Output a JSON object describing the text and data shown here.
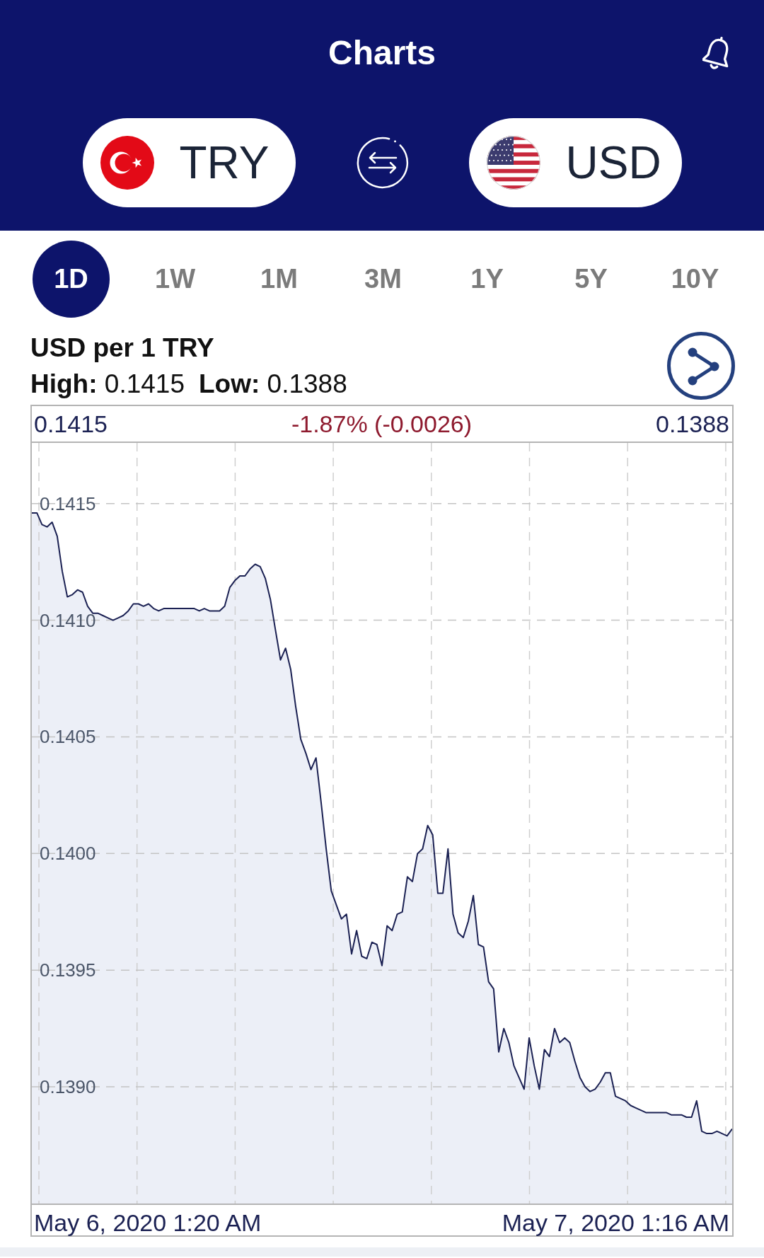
{
  "header": {
    "title": "Charts"
  },
  "currency_pair": {
    "from": {
      "code": "TRY"
    },
    "to": {
      "code": "USD"
    }
  },
  "ranges": [
    {
      "label": "1D",
      "selected": true
    },
    {
      "label": "1W",
      "selected": false
    },
    {
      "label": "1M",
      "selected": false
    },
    {
      "label": "3M",
      "selected": false
    },
    {
      "label": "1Y",
      "selected": false
    },
    {
      "label": "5Y",
      "selected": false
    },
    {
      "label": "10Y",
      "selected": false
    }
  ],
  "summary": {
    "title": "USD per 1 TRY",
    "stats": [
      "**High:** 0.1415",
      "**Low:** 0.1388"
    ]
  },
  "chart": {
    "start_value": "0.1415",
    "change": "-1.87% (-0.0026)",
    "end_value": "0.1388",
    "start_time": "May 6, 2020 1:20 AM",
    "end_time": "May 7, 2020 1:16 AM",
    "chart_data": {
      "type": "area",
      "grid": true,
      "ylim": [
        0.1385,
        0.14176
      ],
      "yticks": [
        {
          "value": 0.139,
          "label": "0.1390"
        },
        {
          "value": 0.1395,
          "label": "0.1395"
        },
        {
          "value": 0.14,
          "label": "0.1400"
        },
        {
          "value": 0.1405,
          "label": "0.1405"
        },
        {
          "value": 0.141,
          "label": "0.1410"
        },
        {
          "value": 0.1415,
          "label": "0.1415"
        }
      ],
      "series": [
        {
          "color": "#1b2153",
          "values": [
            0.14146,
            0.14146,
            0.14141,
            0.1414,
            0.14142,
            0.14136,
            0.14121,
            0.1411,
            0.14111,
            0.14113,
            0.14112,
            0.14106,
            0.14103,
            0.14103,
            0.14102,
            0.14101,
            0.141,
            0.14101,
            0.14102,
            0.14104,
            0.14107,
            0.14107,
            0.14106,
            0.14107,
            0.14105,
            0.14104,
            0.14105,
            0.14105,
            0.14105,
            0.14105,
            0.14105,
            0.14105,
            0.14105,
            0.14104,
            0.14105,
            0.14104,
            0.14104,
            0.14104,
            0.14106,
            0.14114,
            0.14117,
            0.14119,
            0.14119,
            0.14122,
            0.14124,
            0.14123,
            0.14118,
            0.14109,
            0.14096,
            0.14083,
            0.14088,
            0.14079,
            0.14063,
            0.14049,
            0.14043,
            0.14036,
            0.14041,
            0.14022,
            0.14002,
            0.13984,
            0.13978,
            0.13972,
            0.13974,
            0.13957,
            0.13967,
            0.13956,
            0.13955,
            0.13962,
            0.13961,
            0.13952,
            0.13969,
            0.13967,
            0.13974,
            0.13975,
            0.1399,
            0.13988,
            0.14,
            0.14002,
            0.14012,
            0.14008,
            0.13983,
            0.13983,
            0.14002,
            0.13974,
            0.13966,
            0.13964,
            0.13971,
            0.13982,
            0.13961,
            0.1396,
            0.13945,
            0.13942,
            0.13915,
            0.13925,
            0.13919,
            0.13909,
            0.13904,
            0.13899,
            0.13921,
            0.13909,
            0.13899,
            0.13916,
            0.13913,
            0.13925,
            0.13919,
            0.13921,
            0.13919,
            0.13911,
            0.13904,
            0.139,
            0.13898,
            0.13899,
            0.13902,
            0.13906,
            0.13906,
            0.13896,
            0.13895,
            0.13894,
            0.13892,
            0.13891,
            0.1389,
            0.13889,
            0.13889,
            0.13889,
            0.13889,
            0.13889,
            0.13888,
            0.13888,
            0.13888,
            0.13887,
            0.13887,
            0.13894,
            0.13881,
            0.1388,
            0.1388,
            0.13881,
            0.1388,
            0.13879,
            0.13882
          ]
        }
      ]
    }
  }
}
